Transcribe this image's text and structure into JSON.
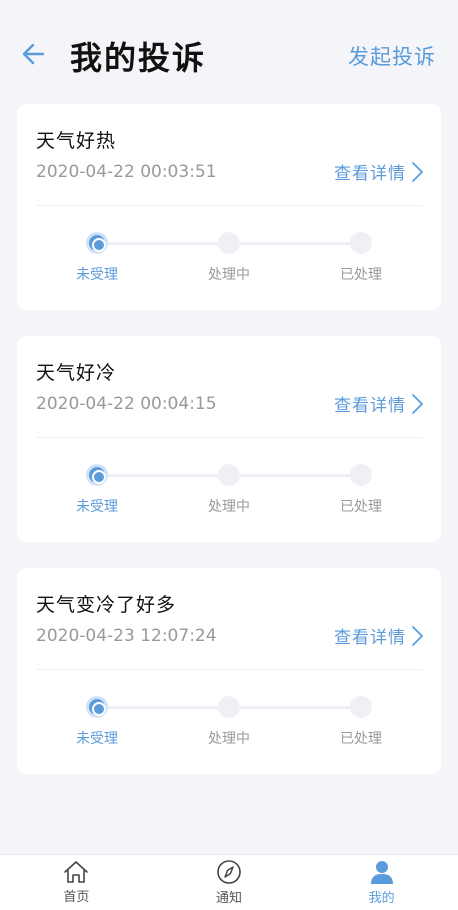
{
  "header": {
    "title": "我的投诉",
    "action": "发起投诉",
    "back_icon": "arrow-left-icon"
  },
  "colors": {
    "accent": "#5b9bdb",
    "muted": "#999999",
    "text": "#111111"
  },
  "complaints": [
    {
      "title": "天气好热",
      "time": "2020-04-22 00:03:51",
      "detail": "查看详情",
      "status_index": 0
    },
    {
      "title": "天气好冷",
      "time": "2020-04-22 00:04:15",
      "detail": "查看详情",
      "status_index": 0
    },
    {
      "title": "天气变冷了好多",
      "time": "2020-04-23 12:07:24",
      "detail": "查看详情",
      "status_index": 0
    }
  ],
  "steps": [
    "未受理",
    "处理中",
    "已处理"
  ],
  "tabbar": [
    {
      "label": "首页",
      "icon": "home-icon",
      "active": false
    },
    {
      "label": "通知",
      "icon": "compass-icon",
      "active": false
    },
    {
      "label": "我的",
      "icon": "user-icon",
      "active": true
    }
  ]
}
